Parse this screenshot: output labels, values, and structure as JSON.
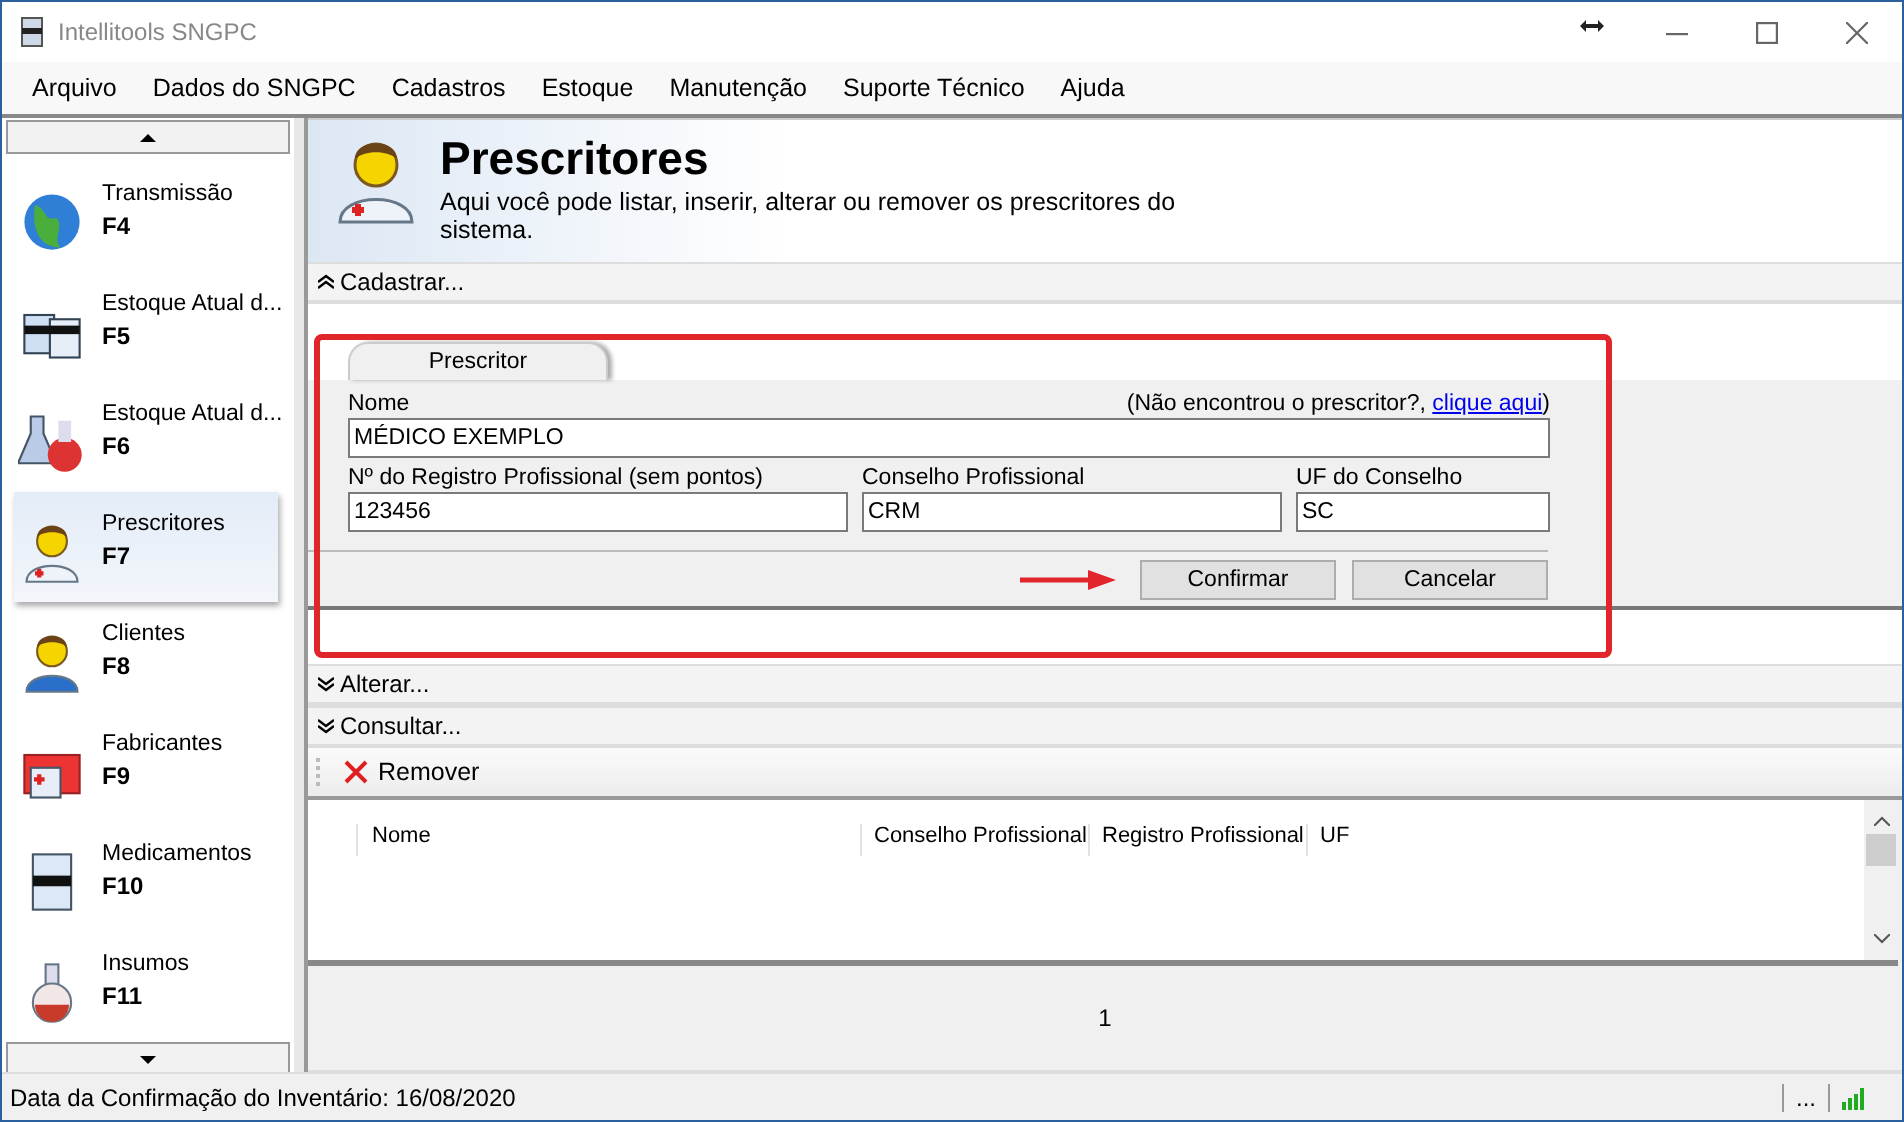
{
  "window": {
    "title": "Intellitools SNGPC"
  },
  "menu": [
    "Arquivo",
    "Dados do SNGPC",
    "Cadastros",
    "Estoque",
    "Manutenção",
    "Suporte Técnico",
    "Ajuda"
  ],
  "sidebar": {
    "items": [
      {
        "label": "Transmissão",
        "key": "F4",
        "selected": false
      },
      {
        "label": "Estoque Atual d...",
        "key": "F5",
        "selected": false
      },
      {
        "label": "Estoque Atual d...",
        "key": "F6",
        "selected": false
      },
      {
        "label": "Prescritores",
        "key": "F7",
        "selected": true
      },
      {
        "label": "Clientes",
        "key": "F8",
        "selected": false
      },
      {
        "label": "Fabricantes",
        "key": "F9",
        "selected": false
      },
      {
        "label": "Medicamentos",
        "key": "F10",
        "selected": false
      },
      {
        "label": "Insumos",
        "key": "F11",
        "selected": false
      }
    ]
  },
  "header": {
    "title": "Prescritores",
    "description": "Aqui você pode listar, inserir, alterar ou remover os prescritores do sistema."
  },
  "sections": [
    {
      "label": "Cadastrar...",
      "expanded": true
    },
    {
      "label": "Alterar...",
      "expanded": false
    },
    {
      "label": "Consultar...",
      "expanded": false
    }
  ],
  "form": {
    "tabs": [
      {
        "label": "Prescritor",
        "selected": true
      }
    ],
    "hint": "(Não encontrou o prescritor?, ",
    "hint_link": "clique aqui",
    "hint_end": ")",
    "fields": [
      {
        "label": "Nome",
        "value": "MÉDICO EXEMPLO"
      },
      {
        "label": "Nº do Registro Profissional (sem pontos)",
        "value": "123456"
      },
      {
        "label": "Conselho Profissional",
        "value": "CRM"
      },
      {
        "label": "UF do Conselho",
        "value": "SC"
      }
    ],
    "buttons": [
      "Confirmar",
      "Cancelar"
    ]
  },
  "toolbar": {
    "remove": "Remover"
  },
  "table": {
    "columns": [
      "Nome",
      "Conselho Profissional",
      "Registro Profissional",
      "UF"
    ]
  },
  "pager": {
    "page": "1"
  },
  "status_bar": {
    "text": "Data da Confirmação do Inventário: 16/08/2020",
    "more": "..."
  }
}
